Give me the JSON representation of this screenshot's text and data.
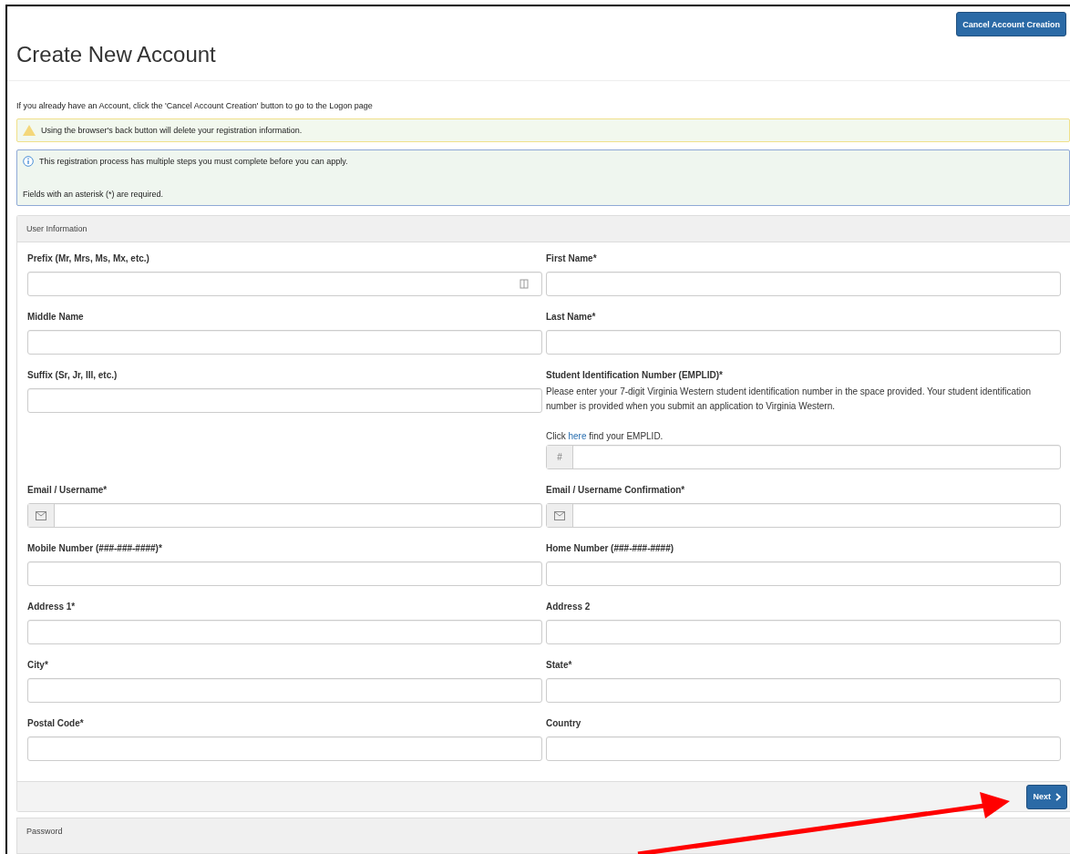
{
  "header": {
    "cancel_button": "Cancel Account Creation",
    "title": "Create New Account"
  },
  "intro": "If you already have an Account, click the 'Cancel Account Creation' button to go to the Logon page",
  "alerts": [
    {
      "kind": "warning",
      "lines": [
        "Using the browser's back button will delete your registration information."
      ]
    },
    {
      "kind": "info",
      "lines": [
        "This registration process has multiple steps you must complete before you can apply.",
        "Fields with an asterisk (*) are required."
      ]
    }
  ],
  "user_information": {
    "heading": "User Information",
    "rows": [
      {
        "left": {
          "label": "Prefix (Mr, Mrs, Ms, Mx, etc.)",
          "kind": "picker"
        },
        "right": {
          "label": "First Name*"
        }
      },
      {
        "left": {
          "label": "Middle Name"
        },
        "right": {
          "label": "Last Name*"
        }
      },
      {
        "left": {
          "label": "Suffix (Sr, Jr, III, etc.)"
        },
        "right": {
          "label": "Student Identification Number (EMPLID)*",
          "help": "Please enter your 7-digit Virginia Western student identification number in the space provided. Your student identification number is provided when you submit an application to Virginia Western.",
          "help_link": {
            "before": "Click ",
            "link": "here",
            "after": " find your EMPLID."
          },
          "addon_text": "#"
        }
      },
      {
        "left": {
          "label": "Email / Username*",
          "kind": "email"
        },
        "right": {
          "label": "Email / Username Confirmation*",
          "kind": "email"
        }
      },
      {
        "left": {
          "label": "Mobile Number (###-###-####)*"
        },
        "right": {
          "label": "Home Number (###-###-####)"
        }
      },
      {
        "left": {
          "label": "Address 1*"
        },
        "right": {
          "label": "Address 2"
        }
      },
      {
        "left": {
          "label": "City*"
        },
        "right": {
          "label": "State*"
        }
      },
      {
        "left": {
          "label": "Postal Code*"
        },
        "right": {
          "label": "Country"
        }
      }
    ],
    "next_button": "Next"
  },
  "password_section": {
    "heading": "Password"
  }
}
